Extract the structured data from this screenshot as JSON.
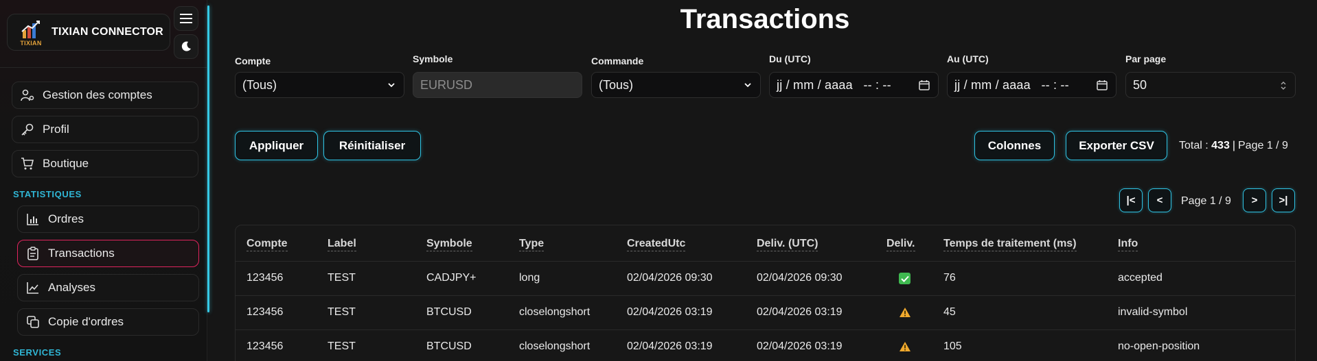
{
  "brand": {
    "name": "TIXIAN CONNECTOR",
    "logo_text": "TIXIAN"
  },
  "sidebar": {
    "items_top": [
      {
        "label": "Gestion des comptes",
        "icon": "users-gear-icon"
      },
      {
        "label": "Profil",
        "icon": "key-icon"
      },
      {
        "label": "Boutique",
        "icon": "cart-icon"
      }
    ],
    "section_stats": "STATISTIQUES",
    "items_stats": [
      {
        "label": "Ordres",
        "icon": "bar-chart-icon"
      },
      {
        "label": "Transactions",
        "icon": "clipboard-icon",
        "active": true
      },
      {
        "label": "Analyses",
        "icon": "line-chart-icon"
      },
      {
        "label": "Copie d'ordres",
        "icon": "copy-icon"
      }
    ],
    "section_services": "SERVICES"
  },
  "page": {
    "title": "Transactions"
  },
  "filters": {
    "compte": {
      "label": "Compte",
      "value": "(Tous)"
    },
    "symbole": {
      "label": "Symbole",
      "placeholder": "EURUSD"
    },
    "commande": {
      "label": "Commande",
      "value": "(Tous)"
    },
    "du": {
      "label": "Du (UTC)",
      "value": "jj / mm / aaaa   -- : --"
    },
    "au": {
      "label": "Au (UTC)",
      "value": "jj / mm / aaaa   -- : --"
    },
    "par_page": {
      "label": "Par page",
      "value": "50"
    }
  },
  "actions": {
    "apply": "Appliquer",
    "reset": "Réinitialiser",
    "columns": "Colonnes",
    "export": "Exporter CSV"
  },
  "summary": {
    "total_label": "Total :",
    "total_value": "433",
    "page_text": "Page 1 / 9"
  },
  "pagination": {
    "first": "|<",
    "prev": "<",
    "label": "Page 1 / 9",
    "next": ">",
    "last": ">|"
  },
  "table": {
    "headers": [
      "Compte",
      "Label",
      "Symbole",
      "Type",
      "CreatedUtc",
      "Deliv. (UTC)",
      "Deliv.",
      "Temps de traitement (ms)",
      "Info"
    ],
    "rows": [
      {
        "compte": "123456",
        "label": "TEST",
        "symbole": "CADJPY+",
        "type": "long",
        "created": "02/04/2026 09:30",
        "deliv_utc": "02/04/2026 09:30",
        "deliv": "ok",
        "temps": "76",
        "info": "accepted"
      },
      {
        "compte": "123456",
        "label": "TEST",
        "symbole": "BTCUSD",
        "type": "closelongshort",
        "created": "02/04/2026 03:19",
        "deliv_utc": "02/04/2026 03:19",
        "deliv": "warning",
        "temps": "45",
        "info": "invalid-symbol"
      },
      {
        "compte": "123456",
        "label": "TEST",
        "symbole": "BTCUSD",
        "type": "closelongshort",
        "created": "02/04/2026 03:19",
        "deliv_utc": "02/04/2026 03:19",
        "deliv": "warning",
        "temps": "105",
        "info": "no-open-position"
      }
    ]
  },
  "colors": {
    "accent": "#2fc3e3",
    "active_border": "#e0245e",
    "section_title": "#30b7d6",
    "ok": "#3fb950",
    "warning": "#f0a92e"
  }
}
